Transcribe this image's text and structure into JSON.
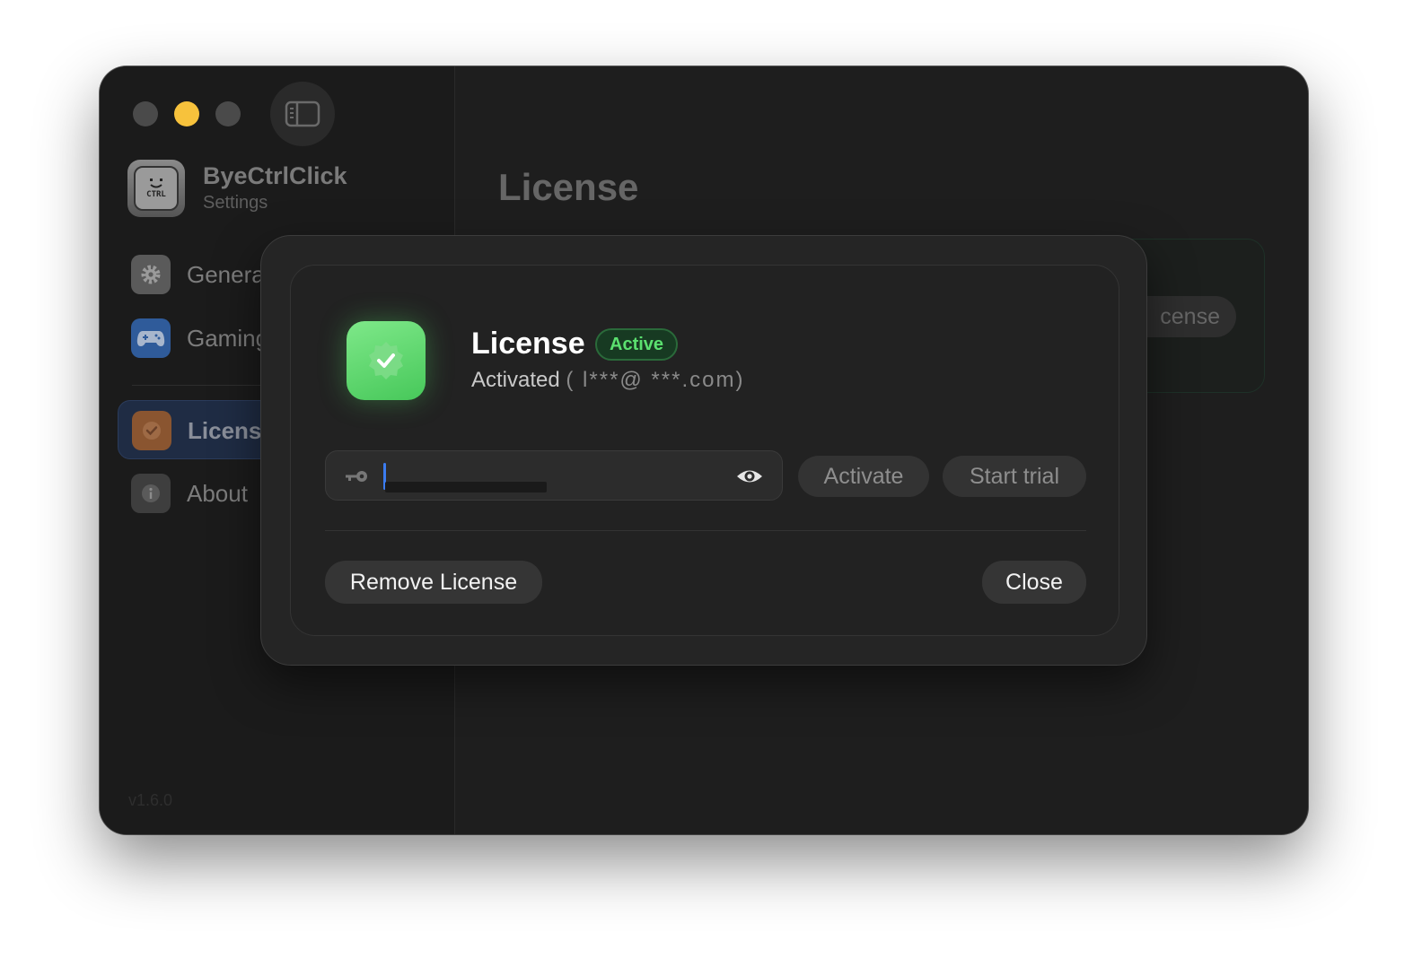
{
  "sidebar": {
    "app_name": "ByeCtrlClick",
    "app_subtitle": "Settings",
    "app_icon_text": "CTRL",
    "items": [
      {
        "label": "Genera",
        "icon": "gear-icon"
      },
      {
        "label": "Gaming",
        "icon": "gamepad-icon"
      },
      {
        "label": "Licens",
        "icon": "license-icon",
        "active": true
      },
      {
        "label": "About",
        "icon": "info-icon"
      }
    ],
    "version": "v1.6.0"
  },
  "main": {
    "title": "License",
    "bg_button_label": "cense"
  },
  "dialog": {
    "title": "License",
    "status_badge": "Active",
    "subtitle": "Activated",
    "subtitle_masked": "( l***@ ***.com)",
    "key_input_value": "",
    "activate_label": "Activate",
    "trial_label": "Start trial",
    "remove_label": "Remove License",
    "close_label": "Close"
  },
  "colors": {
    "accent_green": "#5be06f",
    "traffic_yellow": "#f7c23c",
    "caret_blue": "#3b7cf0"
  }
}
